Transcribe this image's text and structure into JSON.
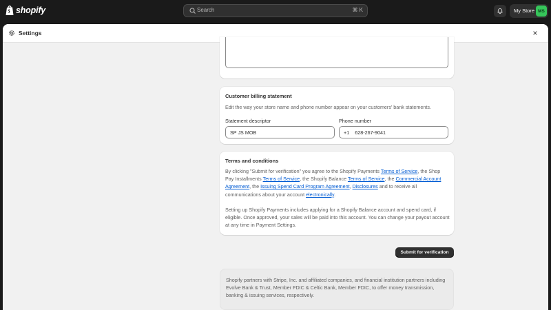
{
  "topbar": {
    "logo_text": "shopify",
    "search_placeholder": "Search",
    "search_shortcut": "⌘ K",
    "store_name": "My Store",
    "avatar_initials": "MS"
  },
  "modal": {
    "title": "Settings",
    "close_glyph": "×"
  },
  "billing": {
    "title": "Customer billing statement",
    "subtitle": "Edit the way your store name and phone number appear on your customers’ bank statements.",
    "descriptor_label": "Statement descriptor",
    "descriptor_value": "SP JS MOB",
    "phone_label": "Phone number",
    "phone_prefix": "+1",
    "phone_value": "628-267-9041"
  },
  "terms": {
    "title": "Terms and conditions",
    "p1_a": "By clicking \"Submit for verification\" you agree to the Shopify Payments ",
    "p1_link1": "Terms of Service",
    "p1_b": ", the Shop Pay Installments ",
    "p1_link2": "Terms of Service",
    "p1_c": ", the Shopify Balance ",
    "p1_link3": "Terms of Service",
    "p1_d": ", the ",
    "p1_link4": "Commercial Account Agreement",
    "p1_e": ", the ",
    "p1_link5": "Issuing Spend Card Program Agreement",
    "p1_f": ", ",
    "p1_link6": "Disclosures",
    "p1_g": " and to receive all communications about your account ",
    "p1_link7": "electronically",
    "p1_h": ".",
    "p2": "Setting up Shopify Payments includes applying for a Shopify Balance account and spend card, if eligible. Once approved, your sales will be paid into this account. You can change your payout account at any time in Payment Settings."
  },
  "submit_label": "Submit for verification",
  "footer_text": "Shopify partners with Stripe, Inc. and affiliated companies, and financial institution partners including Evolve Bank & Trust, Member FDIC & Celtic Bank, Member FDIC, to offer money transmission, banking & issuing services, respectively.",
  "colors": {
    "link": "#005bd3",
    "avatar_bg": "#36c55a",
    "primary_button": "#303030"
  }
}
